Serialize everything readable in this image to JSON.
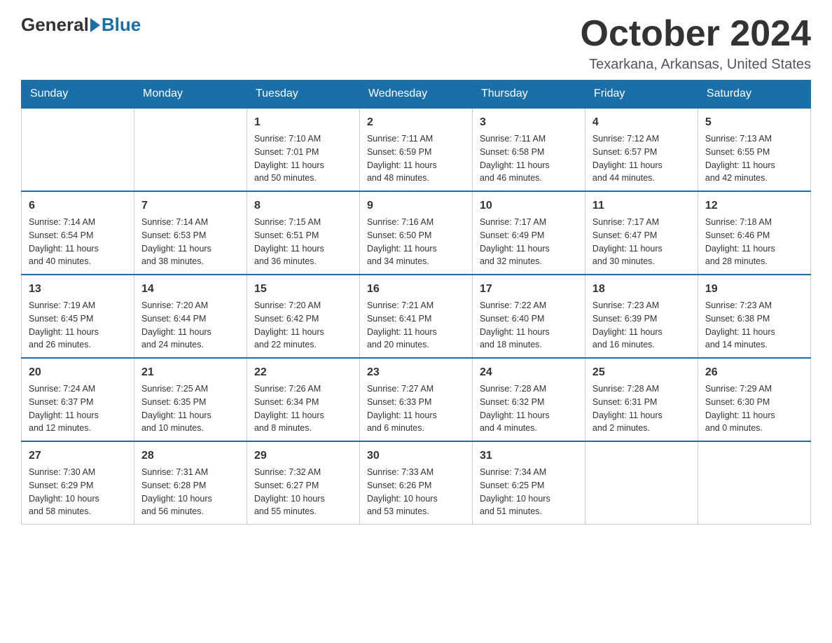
{
  "header": {
    "logo_text_1": "General",
    "logo_text_2": "Blue",
    "month_title": "October 2024",
    "location": "Texarkana, Arkansas, United States"
  },
  "weekdays": [
    "Sunday",
    "Monday",
    "Tuesday",
    "Wednesday",
    "Thursday",
    "Friday",
    "Saturday"
  ],
  "weeks": [
    [
      {
        "day": "",
        "info": ""
      },
      {
        "day": "",
        "info": ""
      },
      {
        "day": "1",
        "info": "Sunrise: 7:10 AM\nSunset: 7:01 PM\nDaylight: 11 hours\nand 50 minutes."
      },
      {
        "day": "2",
        "info": "Sunrise: 7:11 AM\nSunset: 6:59 PM\nDaylight: 11 hours\nand 48 minutes."
      },
      {
        "day": "3",
        "info": "Sunrise: 7:11 AM\nSunset: 6:58 PM\nDaylight: 11 hours\nand 46 minutes."
      },
      {
        "day": "4",
        "info": "Sunrise: 7:12 AM\nSunset: 6:57 PM\nDaylight: 11 hours\nand 44 minutes."
      },
      {
        "day": "5",
        "info": "Sunrise: 7:13 AM\nSunset: 6:55 PM\nDaylight: 11 hours\nand 42 minutes."
      }
    ],
    [
      {
        "day": "6",
        "info": "Sunrise: 7:14 AM\nSunset: 6:54 PM\nDaylight: 11 hours\nand 40 minutes."
      },
      {
        "day": "7",
        "info": "Sunrise: 7:14 AM\nSunset: 6:53 PM\nDaylight: 11 hours\nand 38 minutes."
      },
      {
        "day": "8",
        "info": "Sunrise: 7:15 AM\nSunset: 6:51 PM\nDaylight: 11 hours\nand 36 minutes."
      },
      {
        "day": "9",
        "info": "Sunrise: 7:16 AM\nSunset: 6:50 PM\nDaylight: 11 hours\nand 34 minutes."
      },
      {
        "day": "10",
        "info": "Sunrise: 7:17 AM\nSunset: 6:49 PM\nDaylight: 11 hours\nand 32 minutes."
      },
      {
        "day": "11",
        "info": "Sunrise: 7:17 AM\nSunset: 6:47 PM\nDaylight: 11 hours\nand 30 minutes."
      },
      {
        "day": "12",
        "info": "Sunrise: 7:18 AM\nSunset: 6:46 PM\nDaylight: 11 hours\nand 28 minutes."
      }
    ],
    [
      {
        "day": "13",
        "info": "Sunrise: 7:19 AM\nSunset: 6:45 PM\nDaylight: 11 hours\nand 26 minutes."
      },
      {
        "day": "14",
        "info": "Sunrise: 7:20 AM\nSunset: 6:44 PM\nDaylight: 11 hours\nand 24 minutes."
      },
      {
        "day": "15",
        "info": "Sunrise: 7:20 AM\nSunset: 6:42 PM\nDaylight: 11 hours\nand 22 minutes."
      },
      {
        "day": "16",
        "info": "Sunrise: 7:21 AM\nSunset: 6:41 PM\nDaylight: 11 hours\nand 20 minutes."
      },
      {
        "day": "17",
        "info": "Sunrise: 7:22 AM\nSunset: 6:40 PM\nDaylight: 11 hours\nand 18 minutes."
      },
      {
        "day": "18",
        "info": "Sunrise: 7:23 AM\nSunset: 6:39 PM\nDaylight: 11 hours\nand 16 minutes."
      },
      {
        "day": "19",
        "info": "Sunrise: 7:23 AM\nSunset: 6:38 PM\nDaylight: 11 hours\nand 14 minutes."
      }
    ],
    [
      {
        "day": "20",
        "info": "Sunrise: 7:24 AM\nSunset: 6:37 PM\nDaylight: 11 hours\nand 12 minutes."
      },
      {
        "day": "21",
        "info": "Sunrise: 7:25 AM\nSunset: 6:35 PM\nDaylight: 11 hours\nand 10 minutes."
      },
      {
        "day": "22",
        "info": "Sunrise: 7:26 AM\nSunset: 6:34 PM\nDaylight: 11 hours\nand 8 minutes."
      },
      {
        "day": "23",
        "info": "Sunrise: 7:27 AM\nSunset: 6:33 PM\nDaylight: 11 hours\nand 6 minutes."
      },
      {
        "day": "24",
        "info": "Sunrise: 7:28 AM\nSunset: 6:32 PM\nDaylight: 11 hours\nand 4 minutes."
      },
      {
        "day": "25",
        "info": "Sunrise: 7:28 AM\nSunset: 6:31 PM\nDaylight: 11 hours\nand 2 minutes."
      },
      {
        "day": "26",
        "info": "Sunrise: 7:29 AM\nSunset: 6:30 PM\nDaylight: 11 hours\nand 0 minutes."
      }
    ],
    [
      {
        "day": "27",
        "info": "Sunrise: 7:30 AM\nSunset: 6:29 PM\nDaylight: 10 hours\nand 58 minutes."
      },
      {
        "day": "28",
        "info": "Sunrise: 7:31 AM\nSunset: 6:28 PM\nDaylight: 10 hours\nand 56 minutes."
      },
      {
        "day": "29",
        "info": "Sunrise: 7:32 AM\nSunset: 6:27 PM\nDaylight: 10 hours\nand 55 minutes."
      },
      {
        "day": "30",
        "info": "Sunrise: 7:33 AM\nSunset: 6:26 PM\nDaylight: 10 hours\nand 53 minutes."
      },
      {
        "day": "31",
        "info": "Sunrise: 7:34 AM\nSunset: 6:25 PM\nDaylight: 10 hours\nand 51 minutes."
      },
      {
        "day": "",
        "info": ""
      },
      {
        "day": "",
        "info": ""
      }
    ]
  ]
}
